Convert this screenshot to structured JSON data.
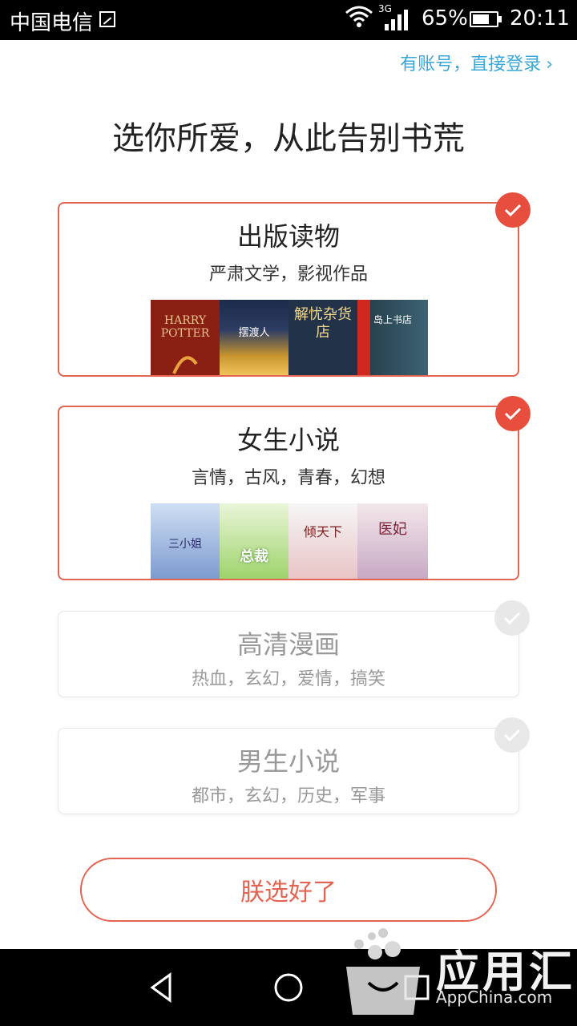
{
  "status_bar": {
    "carrier": "中国电信",
    "network": "3G",
    "battery": "65%",
    "time": "20:11"
  },
  "login_link": {
    "label": "有账号，直接登录",
    "chevron": "›"
  },
  "title": "选你所爱，从此告别书荒",
  "categories": [
    {
      "title": "出版读物",
      "subtitle": "严肃文学，影视作品",
      "selected": true,
      "covers": [
        "HARRY POTTER",
        "摆渡人",
        "解忧杂货店",
        "岛上书店"
      ]
    },
    {
      "title": "女生小说",
      "subtitle": "言情，古风，青春，幻想",
      "selected": true,
      "covers": [
        "三小姐",
        "总裁",
        "倾天下",
        "医妃"
      ]
    },
    {
      "title": "高清漫画",
      "subtitle": "热血，玄幻，爱情，搞笑",
      "selected": false
    },
    {
      "title": "男生小说",
      "subtitle": "都市，玄幻，历史，军事",
      "selected": false
    }
  ],
  "confirm_button": "朕选好了",
  "watermark": {
    "text": "应用汇",
    "sub": "AppChina.com"
  },
  "colors": {
    "accent": "#e26451",
    "check": "#e84e3d",
    "link": "#3aa7d9"
  }
}
